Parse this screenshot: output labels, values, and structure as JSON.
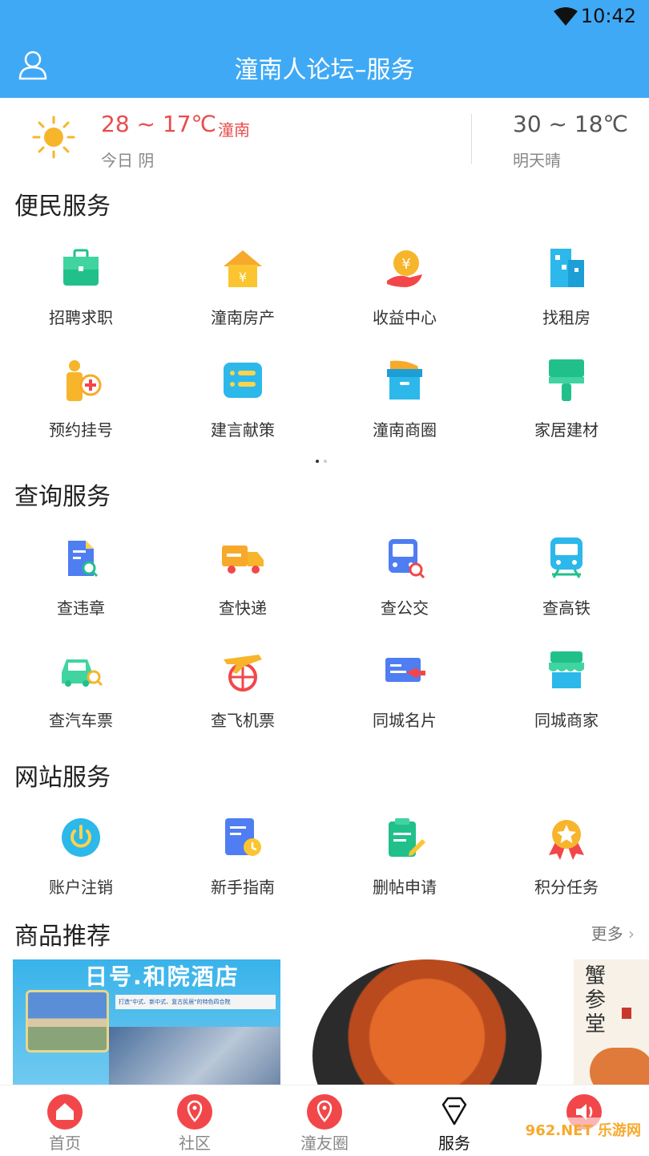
{
  "status_bar": {
    "time": "10:42"
  },
  "header": {
    "title": "潼南人论坛–服务"
  },
  "weather": {
    "today_temp": "28 ~ 17℃",
    "city": "潼南",
    "today_desc": "今日 阴",
    "tomorrow_temp": "30 ~ 18℃",
    "tomorrow_desc": "明天晴"
  },
  "sections": {
    "convenience": {
      "title": "便民服务",
      "items": [
        "招聘求职",
        "潼南房产",
        "收益中心",
        "找租房",
        "预约挂号",
        "建言献策",
        "潼南商圈",
        "家居建材"
      ]
    },
    "query": {
      "title": "查询服务",
      "items": [
        "查违章",
        "查快递",
        "查公交",
        "查高铁",
        "查汽车票",
        "查飞机票",
        "同城名片",
        "同城商家"
      ]
    },
    "site": {
      "title": "网站服务",
      "items": [
        "账户注销",
        "新手指南",
        "删帖申请",
        "积分任务"
      ]
    },
    "products": {
      "title": "商品推荐",
      "more": "更多",
      "banner_text": "日号.和院酒店",
      "banner_sub": "打造\"中式、新中式、复古民居\"的特色四合院",
      "brand_text": "蟹参堂"
    }
  },
  "tabbar": {
    "items": [
      "首页",
      "社区",
      "潼友圈",
      "服务"
    ],
    "active": "服务"
  },
  "watermark": "962.NET 乐游网",
  "colors": {
    "header_bg": "#3fa9f5",
    "accent_red": "#e94c4c",
    "tab_red": "#f2474a"
  }
}
